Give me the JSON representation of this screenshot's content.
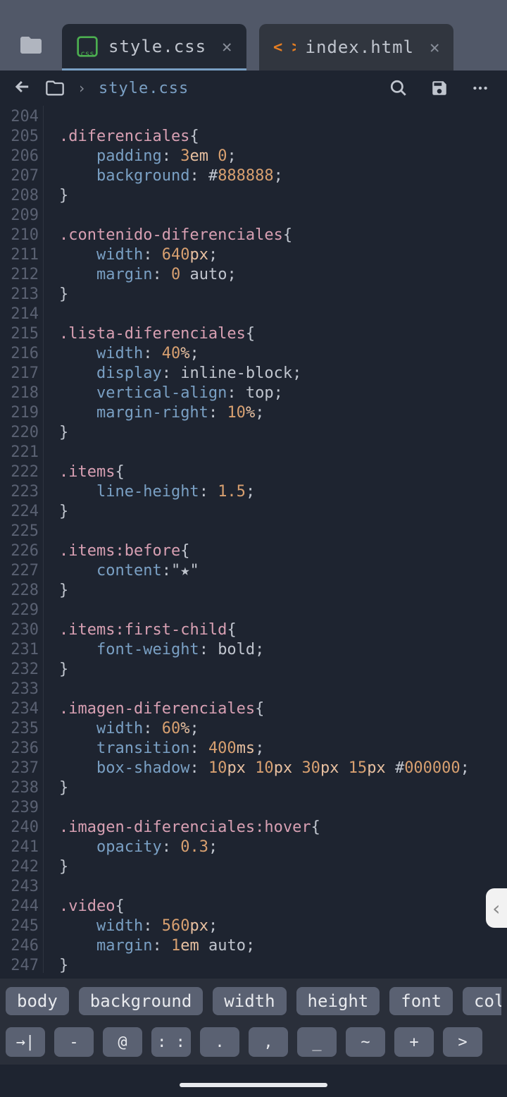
{
  "tabs": [
    {
      "label": "style.css",
      "icon": "css"
    },
    {
      "label": "index.html",
      "icon": "html"
    }
  ],
  "breadcrumb": {
    "filename": "style.css"
  },
  "line_start": 204,
  "line_end": 247,
  "code_lines": [
    {
      "n": 204,
      "html": ""
    },
    {
      "n": 205,
      "html": "<span class='c-sel'>.diferenciales</span><span class='c-punct'>{</span>"
    },
    {
      "n": 206,
      "html": "    <span class='c-prop'>padding</span><span class='c-punct'>:</span> <span class='c-num'>3</span><span class='c-unit'>em</span> <span class='c-num'>0</span><span class='c-punct'>;</span>"
    },
    {
      "n": 207,
      "html": "    <span class='c-prop'>background</span><span class='c-punct'>:</span> <span class='c-punct'>#</span><span class='c-num'>888888</span><span class='c-punct'>;</span>"
    },
    {
      "n": 208,
      "html": "<span class='c-punct'>}</span>"
    },
    {
      "n": 209,
      "html": ""
    },
    {
      "n": 210,
      "html": "<span class='c-sel'>.contenido-diferenciales</span><span class='c-punct'>{</span>"
    },
    {
      "n": 211,
      "html": "    <span class='c-prop'>width</span><span class='c-punct'>:</span> <span class='c-num'>640</span><span class='c-unit'>px</span><span class='c-punct'>;</span>"
    },
    {
      "n": 212,
      "html": "    <span class='c-prop'>margin</span><span class='c-punct'>:</span> <span class='c-num'>0</span> <span class='c-val'>auto</span><span class='c-punct'>;</span>"
    },
    {
      "n": 213,
      "html": "<span class='c-punct'>}</span>"
    },
    {
      "n": 214,
      "html": ""
    },
    {
      "n": 215,
      "html": "<span class='c-sel'>.lista-diferenciales</span><span class='c-punct'>{</span>"
    },
    {
      "n": 216,
      "html": "    <span class='c-prop'>width</span><span class='c-punct'>:</span> <span class='c-num'>40</span><span class='c-unit'>%</span><span class='c-punct'>;</span>"
    },
    {
      "n": 217,
      "html": "    <span class='c-prop'>display</span><span class='c-punct'>:</span> <span class='c-val'>inline-block</span><span class='c-punct'>;</span>"
    },
    {
      "n": 218,
      "html": "    <span class='c-prop'>vertical-align</span><span class='c-punct'>:</span> <span class='c-val'>top</span><span class='c-punct'>;</span>"
    },
    {
      "n": 219,
      "html": "    <span class='c-prop'>margin-right</span><span class='c-punct'>:</span> <span class='c-num'>10</span><span class='c-unit'>%</span><span class='c-punct'>;</span>"
    },
    {
      "n": 220,
      "html": "<span class='c-punct'>}</span>"
    },
    {
      "n": 221,
      "html": ""
    },
    {
      "n": 222,
      "html": "<span class='c-sel'>.items</span><span class='c-punct'>{</span>"
    },
    {
      "n": 223,
      "html": "    <span class='c-prop'>line-height</span><span class='c-punct'>:</span> <span class='c-num'>1.5</span><span class='c-punct'>;</span>"
    },
    {
      "n": 224,
      "html": "<span class='c-punct'>}</span>"
    },
    {
      "n": 225,
      "html": ""
    },
    {
      "n": 226,
      "html": "<span class='c-sel'>.items</span><span class='c-pseudo'>:before</span><span class='c-punct'>{</span>"
    },
    {
      "n": 227,
      "html": "    <span class='c-prop'>content</span><span class='c-punct'>:</span><span class='c-str'>\"★\"</span>"
    },
    {
      "n": 228,
      "html": "<span class='c-punct'>}</span>"
    },
    {
      "n": 229,
      "html": ""
    },
    {
      "n": 230,
      "html": "<span class='c-sel'>.items</span><span class='c-pseudo'>:first-child</span><span class='c-punct'>{</span>"
    },
    {
      "n": 231,
      "html": "    <span class='c-prop'>font-weight</span><span class='c-punct'>:</span> <span class='c-val'>bold</span><span class='c-punct'>;</span>"
    },
    {
      "n": 232,
      "html": "<span class='c-punct'>}</span>"
    },
    {
      "n": 233,
      "html": ""
    },
    {
      "n": 234,
      "html": "<span class='c-sel'>.imagen-diferenciales</span><span class='c-punct'>{</span>"
    },
    {
      "n": 235,
      "html": "    <span class='c-prop'>width</span><span class='c-punct'>:</span> <span class='c-num'>60</span><span class='c-unit'>%</span><span class='c-punct'>;</span>"
    },
    {
      "n": 236,
      "html": "    <span class='c-prop'>transition</span><span class='c-punct'>:</span> <span class='c-num'>400</span><span class='c-unit'>ms</span><span class='c-punct'>;</span>"
    },
    {
      "n": 237,
      "html": "    <span class='c-prop'>box-shadow</span><span class='c-punct'>:</span> <span class='c-num'>10</span><span class='c-unit'>px</span> <span class='c-num'>10</span><span class='c-unit'>px</span> <span class='c-num'>30</span><span class='c-unit'>px</span> <span class='c-num'>15</span><span class='c-unit'>px</span> <span class='c-punct'>#</span><span class='c-num'>000000</span><span class='c-punct'>;</span>"
    },
    {
      "n": 238,
      "html": "<span class='c-punct'>}</span>"
    },
    {
      "n": 239,
      "html": ""
    },
    {
      "n": 240,
      "html": "<span class='c-sel'>.imagen-diferenciales</span><span class='c-pseudo'>:hover</span><span class='c-punct'>{</span>"
    },
    {
      "n": 241,
      "html": "    <span class='c-prop'>opacity</span><span class='c-punct'>:</span> <span class='c-num'>0.3</span><span class='c-punct'>;</span>"
    },
    {
      "n": 242,
      "html": "<span class='c-punct'>}</span>"
    },
    {
      "n": 243,
      "html": ""
    },
    {
      "n": 244,
      "html": "<span class='c-sel'>.video</span><span class='c-punct'>{</span>"
    },
    {
      "n": 245,
      "html": "    <span class='c-prop'>width</span><span class='c-punct'>:</span> <span class='c-num'>560</span><span class='c-unit'>px</span><span class='c-punct'>;</span>"
    },
    {
      "n": 246,
      "html": "    <span class='c-prop'>margin</span><span class='c-punct'>:</span> <span class='c-num'>1</span><span class='c-unit'>em</span> <span class='c-val'>auto</span><span class='c-punct'>;</span>"
    },
    {
      "n": 247,
      "html": "<span class='c-punct'>}</span>"
    }
  ],
  "suggestions": [
    "body",
    "background",
    "width",
    "height",
    "font",
    "color"
  ],
  "keys": [
    "→|",
    "-",
    "@",
    ": :",
    ".",
    ",",
    "_",
    "~",
    "+",
    ">"
  ],
  "sidehint": "css"
}
